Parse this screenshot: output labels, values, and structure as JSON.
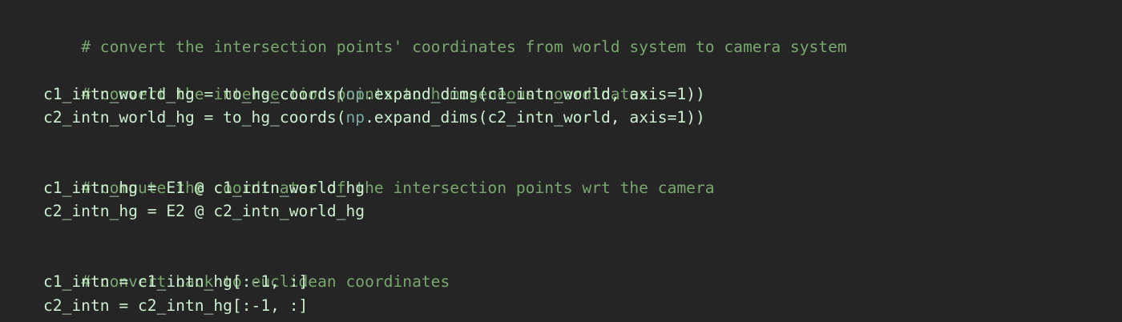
{
  "editor": {
    "background": "#252525",
    "colors": {
      "comment": "#79a66f",
      "identifier": "#ccf0cf",
      "module": "#7aa9a3"
    },
    "lines": [
      {
        "tokens": [
          {
            "type": "comment",
            "text": "# convert the intersection points' coordinates from world system to camera system"
          }
        ]
      },
      {
        "tokens": []
      },
      {
        "tokens": [
          {
            "type": "comment",
            "text": "# convert the intersection points to homogeneous coordinates"
          }
        ]
      },
      {
        "tokens": [
          {
            "type": "ident",
            "text": "c1_intn_world_hg = to_hg_coords("
          },
          {
            "type": "module",
            "text": "np"
          },
          {
            "type": "ident",
            "text": ".expand_dims(c1_intn_world, axis=1))"
          }
        ]
      },
      {
        "tokens": [
          {
            "type": "ident",
            "text": "c2_intn_world_hg = to_hg_coords("
          },
          {
            "type": "module",
            "text": "np"
          },
          {
            "type": "ident",
            "text": ".expand_dims(c2_intn_world, axis=1))"
          }
        ]
      },
      {
        "tokens": []
      },
      {
        "tokens": [
          {
            "type": "comment",
            "text": "# compute the coordinates of the intersection points wrt the camera"
          }
        ]
      },
      {
        "tokens": [
          {
            "type": "ident",
            "text": "c1_intn_hg = E1 @ c1_intn_world_hg"
          }
        ]
      },
      {
        "tokens": [
          {
            "type": "ident",
            "text": "c2_intn_hg = E2 @ c2_intn_world_hg"
          }
        ]
      },
      {
        "tokens": []
      },
      {
        "tokens": [
          {
            "type": "comment",
            "text": "# convert back to euclidean coordinates"
          }
        ]
      },
      {
        "tokens": [
          {
            "type": "ident",
            "text": "c1_intn = c1_intn_hg[:-1, :]"
          }
        ]
      },
      {
        "tokens": [
          {
            "type": "ident",
            "text": "c2_intn = c2_intn_hg[:-1, :]"
          }
        ]
      }
    ]
  }
}
